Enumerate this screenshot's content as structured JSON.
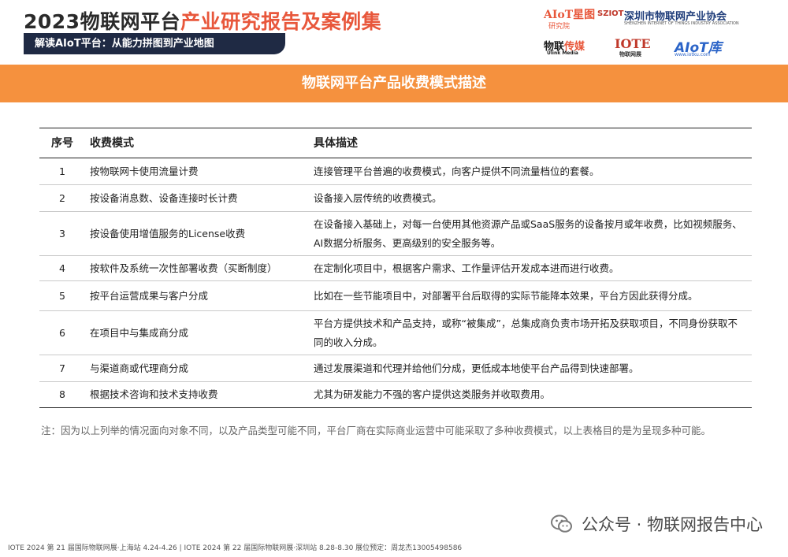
{
  "header": {
    "title_part1": "2023物联网平台",
    "title_part2": "产业研究报告及案例集",
    "subtitle": "解读AIoT平台：从能力拼图到产业地图"
  },
  "logos": {
    "aiot": "AIoT星图",
    "aiot_sub": "研究院",
    "sziot": "SZIOT",
    "sziot_name": "深圳市物联网产业协会",
    "sziot_en": "SHENZHEN INTERNET OF THINGS INDUSTRY ASSOCIATION",
    "ulink_a": "物联",
    "ulink_b": "传媒",
    "ulink_en": "Ulink Media",
    "iote": "IOTE",
    "iote_sub": "物联网展",
    "aiotku": "AIoT库",
    "aiotku_url": "www.iotku.com"
  },
  "banner": {
    "title": "物联网平台产品收费模式描述"
  },
  "table": {
    "headers": [
      "序号",
      "收费模式",
      "具体描述"
    ],
    "rows": [
      {
        "no": "1",
        "mode": "按物联网卡使用流量计费",
        "desc": "连接管理平台普遍的收费模式，向客户提供不同流量档位的套餐。"
      },
      {
        "no": "2",
        "mode": "按设备消息数、设备连接时长计费",
        "desc": "设备接入层传统的收费模式。"
      },
      {
        "no": "3",
        "mode": "按设备使用增值服务的License收费",
        "desc": "在设备接入基础上，对每一台使用其他资源产品或SaaS服务的设备按月或年收费，比如视频服务、AI数据分析服务、更高级别的安全服务等。"
      },
      {
        "no": "4",
        "mode": "按软件及系统一次性部署收费（买断制度）",
        "desc": "在定制化项目中，根据客户需求、工作量评估开发成本进而进行收费。"
      },
      {
        "no": "5",
        "mode": "按平台运营成果与客户分成",
        "desc": "比如在一些节能项目中，对部署平台后取得的实际节能降本效果，平台方因此获得分成。"
      },
      {
        "no": "6",
        "mode": "在项目中与集成商分成",
        "desc": "平台方提供技术和产品支持，或称“被集成”，总集成商负责市场开拓及获取项目，不同身份获取不同的收入分成。"
      },
      {
        "no": "7",
        "mode": "与渠道商或代理商分成",
        "desc": "通过发展渠道和代理并给他们分成，更低成本地使平台产品得到快速部署。"
      },
      {
        "no": "8",
        "mode": "根据技术咨询和技术支持收费",
        "desc": "尤其为研发能力不强的客户提供这类服务并收取费用。"
      }
    ]
  },
  "note": "注：因为以上列举的情况面向对象不同，以及产品类型可能不同，平台厂商在实际商业运营中可能采取了多种收费模式，以上表格目的是为呈现多种可能。",
  "wechat": {
    "label": "公众号 · 物联网报告中心"
  },
  "footer": "IOTE 2024 第 21 届国际物联网展·上海站 4.24-4.26 | IOTE 2024 第 22 届国际物联网展·深圳站 8.28-8.30  展位预定：周龙杰13005498586",
  "colors": {
    "accent": "#f5913e",
    "title_red": "#e8573b",
    "navy": "#1f2a44"
  }
}
